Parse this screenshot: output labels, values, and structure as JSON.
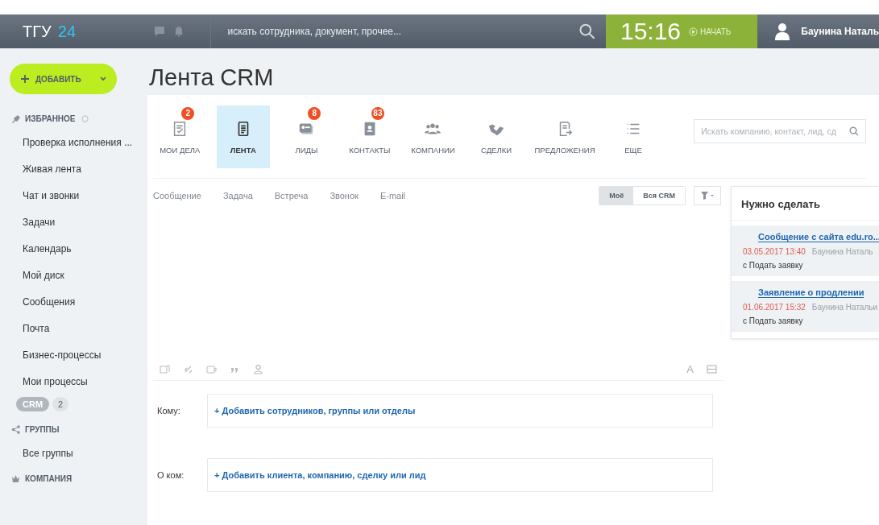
{
  "header": {
    "logo": "ТГУ",
    "logo_accent": "24",
    "search_placeholder": "искать сотрудника, документ, прочее...",
    "time": "15:16",
    "start_button": "НАЧАТЬ",
    "user_name": "Баунина Наталь"
  },
  "sidebar": {
    "add_button": "ДОБАВИТЬ",
    "sections": [
      {
        "title": "ИЗБРАННОЕ",
        "items": [
          "Проверка исполнения ...",
          "Живая лента",
          "Чат и звонки",
          "Задачи",
          "Календарь",
          "Мой диск",
          "Сообщения",
          "Почта",
          "Бизнес-процессы",
          "Мои процессы"
        ],
        "badge": {
          "label": "CRM",
          "count": "2"
        }
      },
      {
        "title": "ГРУППЫ",
        "items": [
          "Все группы"
        ]
      },
      {
        "title": "КОМПАНИЯ"
      }
    ]
  },
  "main": {
    "title": "Лента CRM",
    "crm_tabs": [
      {
        "label": "МОИ ДЕЛА",
        "count": "2",
        "selected": false
      },
      {
        "label": "ЛЕНТА",
        "selected": true
      },
      {
        "label": "ЛИДЫ",
        "count": "8",
        "selected": false
      },
      {
        "label": "КОНТАКТЫ",
        "count": "83",
        "selected": false
      },
      {
        "label": "КОМПАНИИ",
        "selected": false
      },
      {
        "label": "СДЕЛКИ",
        "selected": false
      },
      {
        "label": "ПРЕДЛОЖЕНИЯ",
        "selected": false
      },
      {
        "label": "ЕЩЕ",
        "selected": false
      }
    ],
    "search_placeholder": "Искать компанию, контакт, лид, сд",
    "post_tabs": [
      "Сообщение",
      "Задача",
      "Встреча",
      "Звонок",
      "E-mail"
    ],
    "scope": [
      {
        "label": "Моё",
        "selected": true
      },
      {
        "label": "Вся CRM",
        "selected": false
      }
    ],
    "editor": {
      "font_button": "A"
    },
    "recipients": [
      {
        "label": "Кому:",
        "action": "+ Добавить сотрудников, группы или отделы"
      },
      {
        "label": "О ком:",
        "action": "+ Добавить клиента, компанию, сделку или лид"
      }
    ],
    "todo": {
      "title": "Нужно сделать",
      "items": [
        {
          "subject": "Сообщение с сайта edu.ro...",
          "date": "03.05.2017 13:40",
          "author": "Баунина Наталь",
          "source": "с Подать заявку"
        },
        {
          "subject": "Заявление о продлении",
          "date": "01.06.2017 15:32",
          "author": "Баунина Натальи",
          "source": "с Подать заявку"
        }
      ]
    }
  }
}
